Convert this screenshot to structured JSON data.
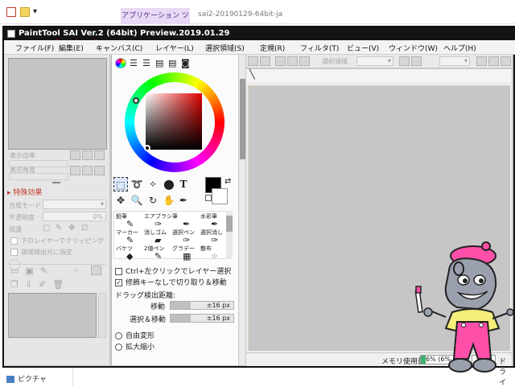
{
  "explorer": {
    "ribbon_tab": "アプリケーション ツール",
    "window_title": "sai2-20190129-64bit-ja",
    "nav_item": "ピクチャ"
  },
  "window": {
    "title": "PaintTool SAI Ver.2 (64bit) Preview.2019.01.29"
  },
  "menu": [
    "ファイル(F)",
    "編集(E)",
    "キャンバス(C)",
    "レイヤー(L)",
    "選択領域(S)",
    "定規(R)",
    "フィルタ(T)",
    "ビュー(V)",
    "ウィンドウ(W)",
    "ヘルプ(H)"
  ],
  "left_panel": {
    "zoom_label": "表示倍率",
    "angle_label": "表示角度",
    "special_effects": "特殊効果",
    "blend_mode_label": "合成モード",
    "opacity_label": "不透明度",
    "opacity_value": "0%",
    "protect_label": "保護",
    "clip_label": "下のレイヤーでクリッピング",
    "selection_source_label": "領域検出元に指定"
  },
  "tools": {
    "text_tool": "T",
    "brushes": [
      {
        "name": "鉛筆",
        "icon": "pencil-icon",
        "glyph": "✎"
      },
      {
        "name": "エアブラシ",
        "icon": "airbrush-icon",
        "glyph": "✑"
      },
      {
        "name": "筆",
        "icon": "brush-icon",
        "glyph": "✒"
      },
      {
        "name": "水彩筆",
        "icon": "watercolor-icon",
        "glyph": "✒"
      },
      {
        "name": "マーカー",
        "icon": "marker-icon",
        "glyph": "✎"
      },
      {
        "name": "消しゴム",
        "icon": "eraser-icon",
        "glyph": "▰"
      },
      {
        "name": "選択ペン",
        "icon": "select-pen-icon",
        "glyph": "✑"
      },
      {
        "name": "選択消し",
        "icon": "select-erase-icon",
        "glyph": "✑"
      },
      {
        "name": "バケツ",
        "icon": "bucket-icon",
        "glyph": "◆"
      },
      {
        "name": "2値ペン",
        "icon": "binary-pen-icon",
        "glyph": "✎"
      },
      {
        "name": "グラデー",
        "icon": "gradient-icon",
        "glyph": "▦"
      },
      {
        "name": "散布",
        "icon": "scatter-icon",
        "glyph": "⁘"
      }
    ],
    "ctrl_click_label": "Ctrl+左クリックでレイヤー選択",
    "modifier_label": "修飾キーなしで切り取り＆移動",
    "modifier_checked": true,
    "drag_distance_label": "ドラッグ検出距離:",
    "move_label": "移動",
    "move_value": "±16 px",
    "select_move_label": "選択＆移動",
    "select_move_value": "±16 px",
    "free_transform_label": "自由変形",
    "scale_label": "拡大縮小"
  },
  "canvas_toolbar": {
    "selection_area_label": "選択領域"
  },
  "status": {
    "memory_label": "メモリ使用量",
    "memory_value": "6% (6%",
    "drive_label": "ドライ"
  },
  "colors": {
    "titlebar": "#141414",
    "accent_orange": "#d9722a",
    "canvas": "#c6c6c6",
    "mascot_pink": "#ff4fa8",
    "mascot_yellow": "#f5ee7a"
  }
}
